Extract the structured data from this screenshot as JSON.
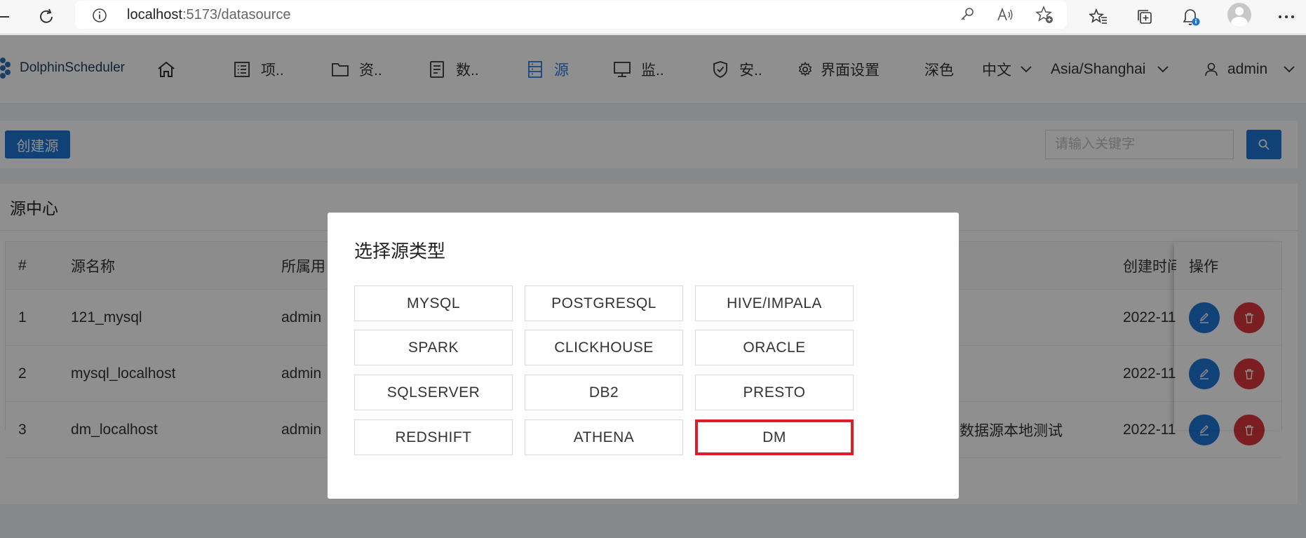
{
  "browser": {
    "url_host": "localhost",
    "url_path": ":5173/datasource"
  },
  "header": {
    "logo_text": "DolphinScheduler",
    "nav": [
      {
        "label": "",
        "icon": "home-icon"
      },
      {
        "label": "项..",
        "icon": "project-icon"
      },
      {
        "label": "资..",
        "icon": "folder-icon"
      },
      {
        "label": "数..",
        "icon": "data-quality-icon"
      },
      {
        "label": "源",
        "icon": "datasource-icon",
        "active": true
      },
      {
        "label": "监..",
        "icon": "monitor-icon"
      },
      {
        "label": "安..",
        "icon": "security-icon"
      }
    ],
    "ui_settings_label": "界面设置",
    "theme_label": "深色",
    "language_label": "中文",
    "timezone_label": "Asia/Shanghai",
    "user_label": "admin"
  },
  "toolbar": {
    "create_label": "创建源",
    "search_placeholder": "请输入关键字"
  },
  "content": {
    "title": "源中心",
    "columns": [
      "#",
      "源名称",
      "所属用",
      "创建时间",
      "操作"
    ],
    "rows": [
      {
        "index": "1",
        "name": "121_mysql",
        "user": "admin",
        "desc": "",
        "created": "2022-11"
      },
      {
        "index": "2",
        "name": "mysql_localhost",
        "user": "admin",
        "desc": "",
        "created": "2022-11"
      },
      {
        "index": "3",
        "name": "dm_localhost",
        "user": "admin",
        "desc": "数据源本地测试",
        "created": "2022-11"
      }
    ]
  },
  "modal": {
    "title": "选择源类型",
    "types": [
      "MYSQL",
      "POSTGRESQL",
      "HIVE/IMPALA",
      "SPARK",
      "CLICKHOUSE",
      "ORACLE",
      "SQLSERVER",
      "DB2",
      "PRESTO",
      "REDSHIFT",
      "ATHENA",
      "DM"
    ],
    "highlighted": "DM"
  },
  "colors": {
    "primary": "#1e74d4",
    "danger": "#d9363e",
    "highlight_border": "#e01b2b",
    "nav_active": "#2a7de1"
  }
}
